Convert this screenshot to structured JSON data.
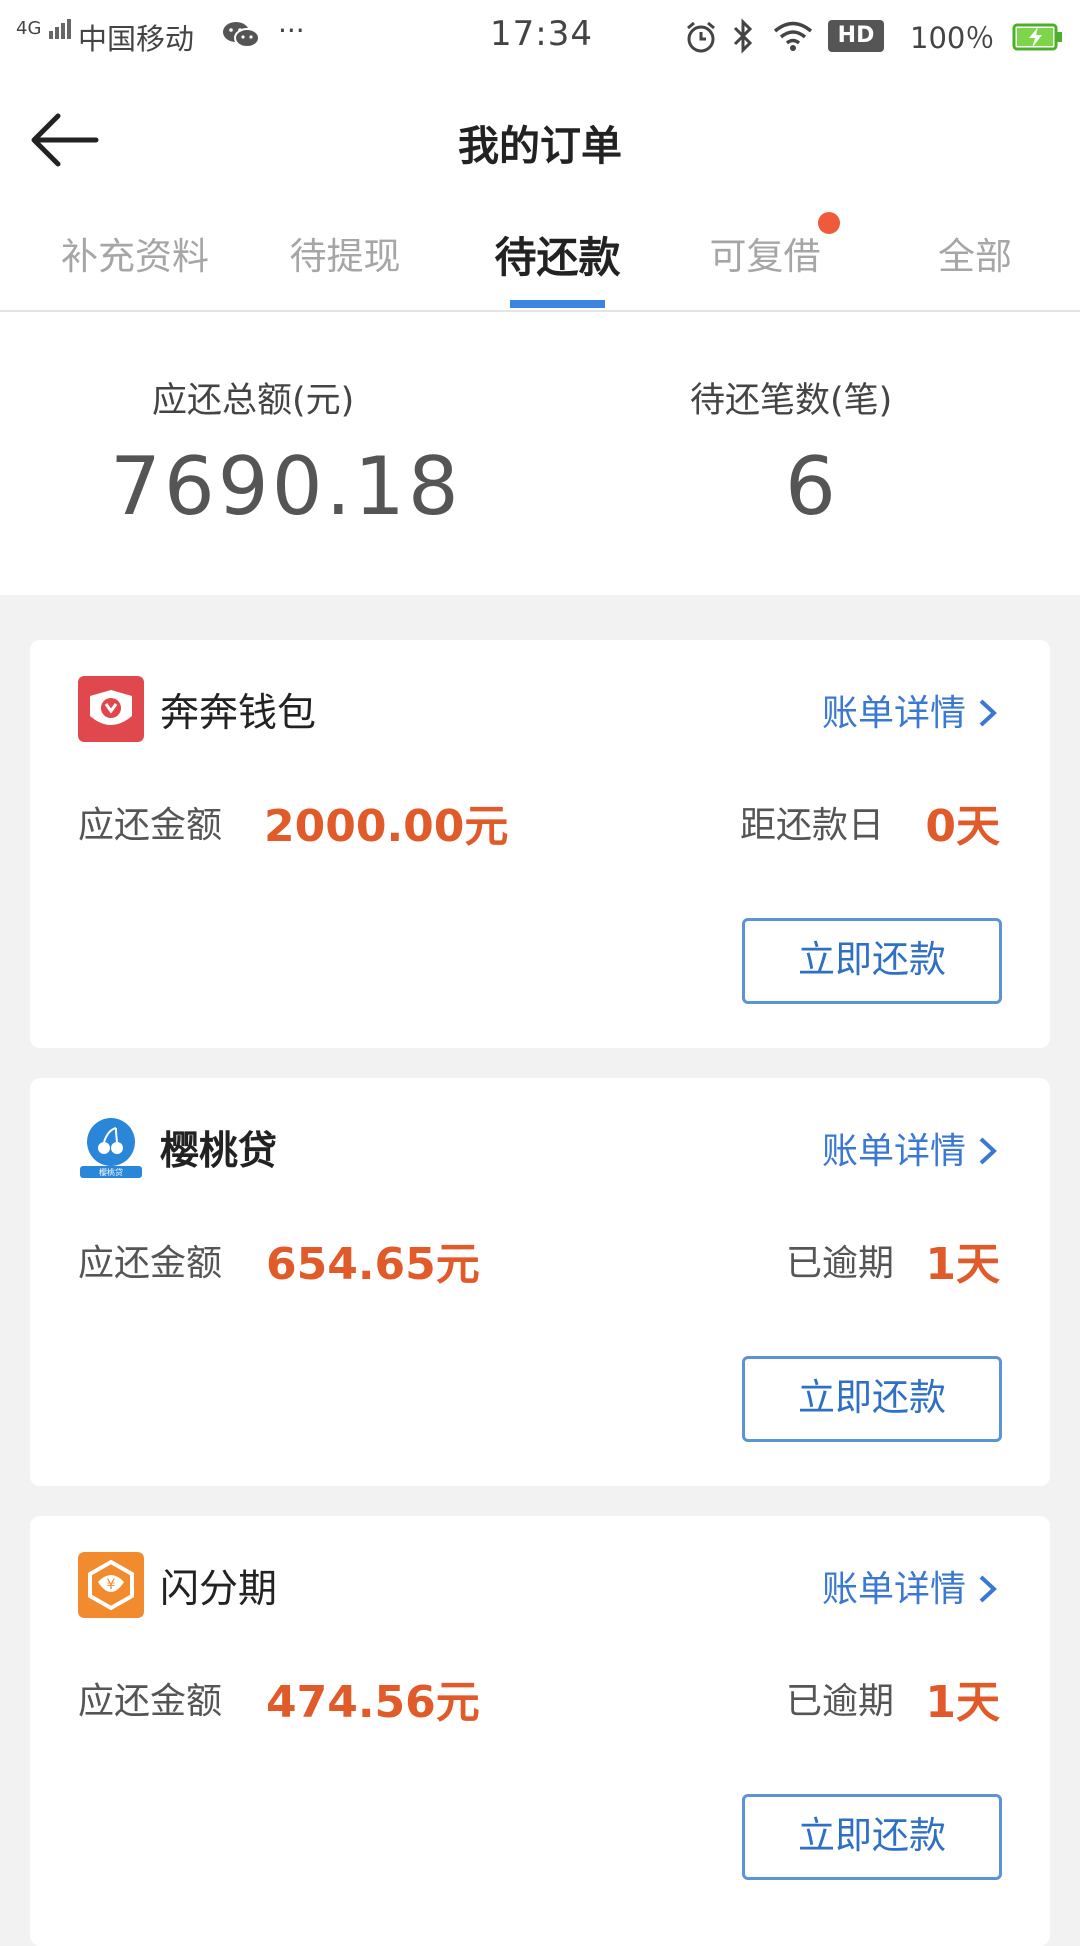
{
  "status_bar": {
    "network": "4G",
    "carrier": "中国移动",
    "more": "···",
    "time": "17:34",
    "hd": "HD",
    "battery": "100％"
  },
  "header": {
    "title": "我的订单"
  },
  "tabs": [
    {
      "label": "补充资料"
    },
    {
      "label": "待提现"
    },
    {
      "label": "待还款",
      "active": true
    },
    {
      "label": "可复借",
      "has_dot": true
    },
    {
      "label": "全部"
    }
  ],
  "summary": {
    "total_label": "应还总额(元)",
    "total_value": "7690.18",
    "count_label": "待还笔数(笔)",
    "count_value": "6"
  },
  "orders": [
    {
      "name": "奔奔钱包",
      "logo_icon": "benben-wallet-icon",
      "detail_label": "账单详情",
      "amount_label": "应还金额",
      "amount_value": "2000.00元",
      "days_label": "距还款日",
      "days_value": "0天",
      "pay_label": "立即还款"
    },
    {
      "name": "樱桃贷",
      "logo_icon": "cherry-loan-icon",
      "logo_caption": "樱桃贷",
      "detail_label": "账单详情",
      "amount_label": "应还金额",
      "amount_value": "654.65元",
      "days_label": "已逾期",
      "days_value": "1天",
      "pay_label": "立即还款"
    },
    {
      "name": "闪分期",
      "logo_icon": "shan-fenqi-icon",
      "detail_label": "账单详情",
      "amount_label": "应还金额",
      "amount_value": "474.56元",
      "days_label": "已逾期",
      "days_value": "1天",
      "pay_label": "立即还款"
    }
  ],
  "colors": {
    "accent_blue": "#3a78d3",
    "amount_orange": "#e05a2a",
    "tab_underline": "#3b85e0",
    "notification_dot": "#f0593a"
  }
}
